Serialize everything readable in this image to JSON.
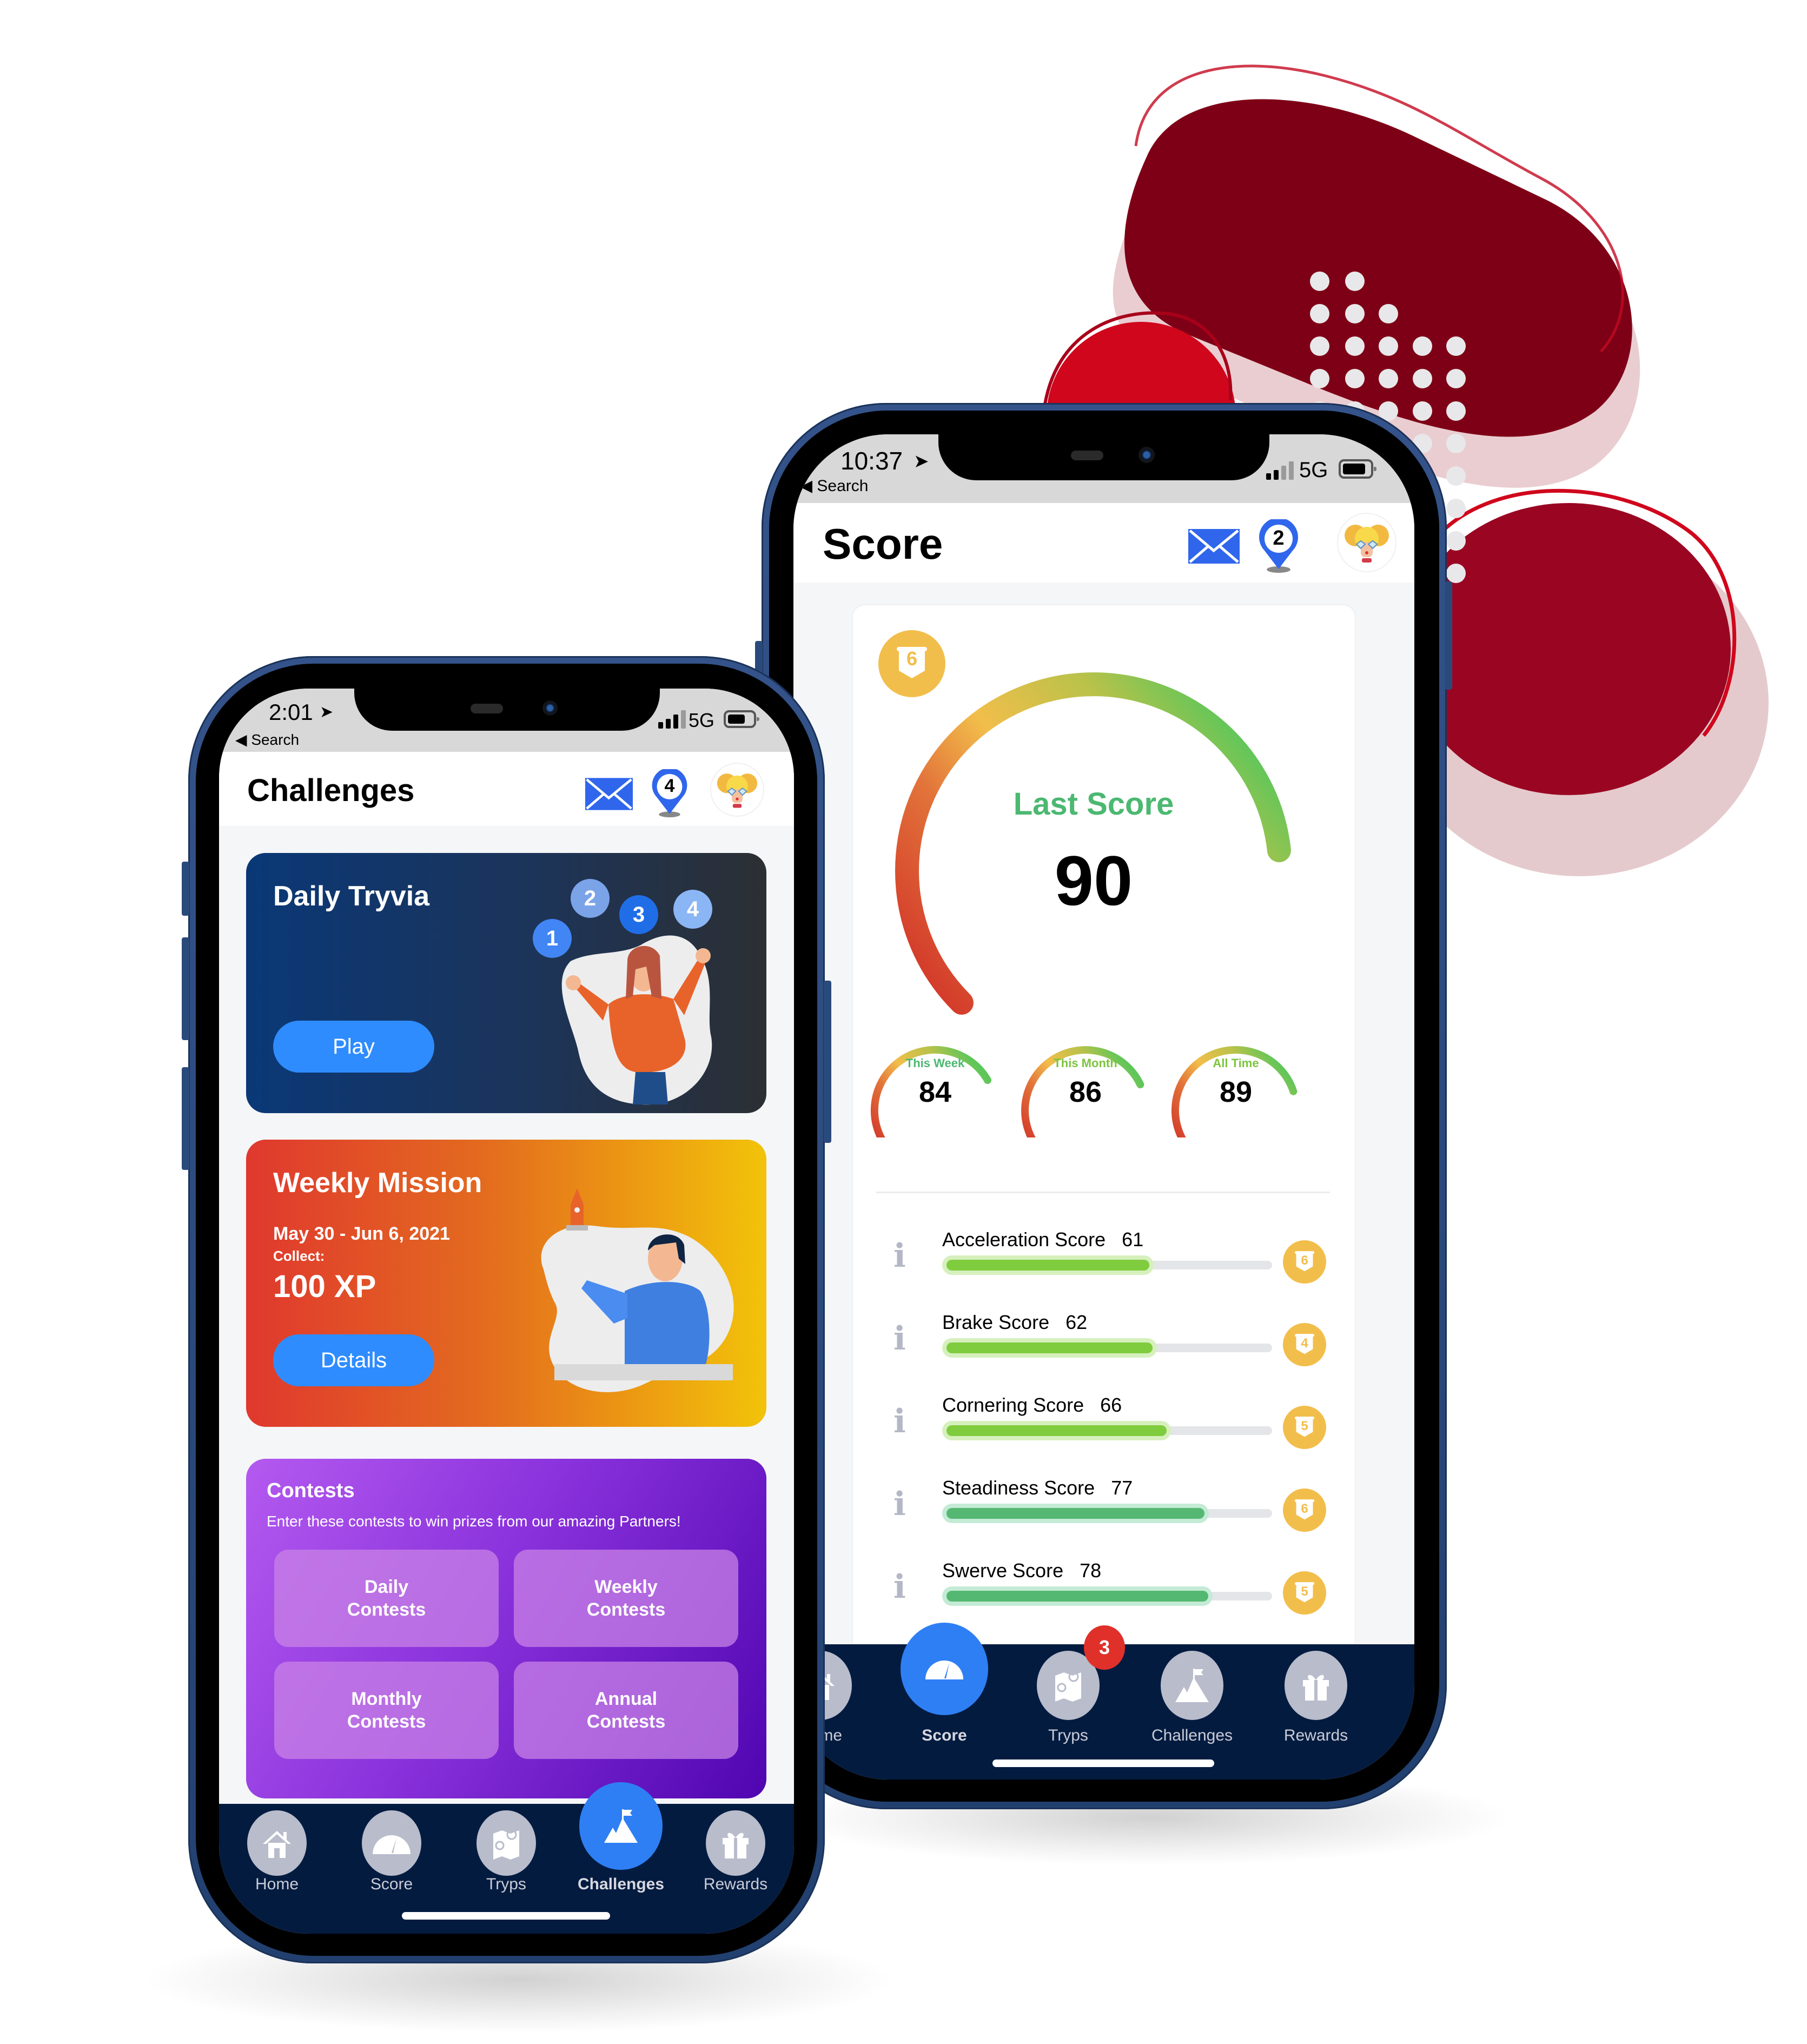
{
  "colors": {
    "brand_red_dark": "#7e0016",
    "brand_red": "#d0061c",
    "brand_red_mid": "#9a0622",
    "frame_blue": "#2c4a7e",
    "tabbar_navy": "#041b40",
    "accent_blue": "#2e8cff",
    "active_tab_blue": "#2f7ff4",
    "inactive_tab_gray": "#b8bccb",
    "level_gold": "#f2be4b",
    "score_green": "#4cb871",
    "bar_green_light": "#7fcc3f",
    "bar_green": "#55b872",
    "badge_red": "#e0302a",
    "gauge_red": "#d02e27",
    "gauge_yellow": "#f2be4b",
    "gauge_green": "#63c65a"
  },
  "phone_left": {
    "status": {
      "time": "2:01",
      "back_label": "Search",
      "network": "5G",
      "battery_level": 0.7
    },
    "header": {
      "title": "Challenges",
      "mail_icon": "mail-icon",
      "pin_count": "4",
      "avatar": "avatar-girl-icon"
    },
    "daily_tryvia": {
      "title": "Daily Tryvia",
      "button": "Play",
      "bubbles": [
        "1",
        "2",
        "3",
        "4"
      ],
      "illustration": "woman-juggling-illustration"
    },
    "weekly_mission": {
      "title": "Weekly Mission",
      "dates": "May 30 - Jun 6, 2021",
      "collect_label": "Collect:",
      "reward": "100 XP",
      "button": "Details",
      "illustration": "man-rocket-illustration"
    },
    "contests": {
      "title": "Contests",
      "subtitle": "Enter these contests to win prizes from our amazing Partners!",
      "buttons": [
        "Daily\nContests",
        "Weekly\nContests",
        "Monthly\nContests",
        "Annual\nContests"
      ]
    },
    "tabs": [
      {
        "label": "Home",
        "icon": "home-icon",
        "active": false
      },
      {
        "label": "Score",
        "icon": "speedometer-icon",
        "active": false
      },
      {
        "label": "Tryps",
        "icon": "map-icon",
        "active": false
      },
      {
        "label": "Challenges",
        "icon": "mountain-flag-icon",
        "active": true
      },
      {
        "label": "Rewards",
        "icon": "gift-icon",
        "active": false
      }
    ]
  },
  "phone_right": {
    "status": {
      "time": "10:37",
      "back_label": "Search",
      "network": "5G",
      "battery_level": 0.85
    },
    "header": {
      "title": "Score",
      "mail_icon": "mail-icon",
      "pin_count": "2",
      "avatar": "avatar-girl-icon"
    },
    "level": "6",
    "last_score": {
      "label": "Last Score",
      "value": "90",
      "percent": 90
    },
    "period_scores": [
      {
        "label": "This Week",
        "value": "84",
        "percent": 84
      },
      {
        "label": "This Month",
        "value": "86",
        "percent": 86
      },
      {
        "label": "All Time",
        "value": "89",
        "percent": 89
      }
    ],
    "sub_scores": [
      {
        "label": "Acceleration Score",
        "value": "61",
        "percent": 61,
        "level": "6"
      },
      {
        "label": "Brake Score",
        "value": "62",
        "percent": 62,
        "level": "4"
      },
      {
        "label": "Cornering Score",
        "value": "66",
        "percent": 66,
        "level": "5"
      },
      {
        "label": "Steadiness Score",
        "value": "77",
        "percent": 77,
        "level": "6"
      },
      {
        "label": "Swerve Score",
        "value": "78",
        "percent": 78,
        "level": "5"
      }
    ],
    "tabs": [
      {
        "label": "Home",
        "icon": "home-icon",
        "active": false
      },
      {
        "label": "Score",
        "icon": "speedometer-icon",
        "active": true
      },
      {
        "label": "Tryps",
        "icon": "map-icon",
        "active": false,
        "badge": "3"
      },
      {
        "label": "Challenges",
        "icon": "mountain-flag-icon",
        "active": false
      },
      {
        "label": "Rewards",
        "icon": "gift-icon",
        "active": false
      }
    ]
  }
}
